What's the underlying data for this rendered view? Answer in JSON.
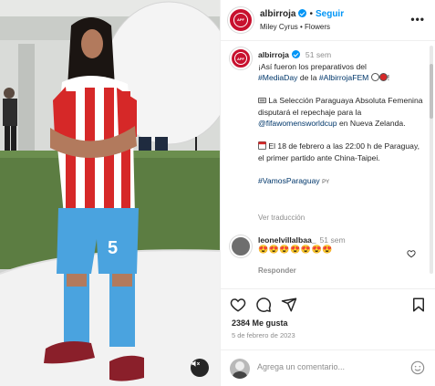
{
  "post": {
    "author": "albirroja",
    "follow_label": "Seguir",
    "audio": "Miley Cyrus • Flowers",
    "more_label": "•••"
  },
  "caption": {
    "username": "albirroja",
    "time": "51 sem",
    "line1_text": "¡Así fueron los preparativos del",
    "line2_tag1": "#MediaDay",
    "line2_mid": " de la ",
    "line2_tag2": "#AlbirrojaFEM",
    "line2_end": "!",
    "p2_start": "La Selección Paraguaya Absoluta Femenina disputará el repechaje para la ",
    "p2_tag": "@fifawomensworldcup",
    "p2_end": " en Nueva Zelanda.",
    "p3_text": "El 18 de febrero a las 22:00 h de Paraguay, el primer partido ante China-Taipei.",
    "p4_tag": "#VamosParaguay",
    "p4_flag": "PY",
    "translate_label": "Ver traducción"
  },
  "comment": {
    "username": "leonelvillalbaa_",
    "time": "51 sem",
    "text": "😍😍😍😍😍😍😍",
    "reply_label": "Responder"
  },
  "stats": {
    "likes": "2384 Me gusta",
    "date": "5 de febrero de 2023"
  },
  "add_comment": {
    "placeholder": "Agrega un comentario..."
  },
  "player": {
    "jersey_number": "5"
  },
  "colors": {
    "accent": "#0095f6",
    "brand_red": "#c8102e",
    "link": "#00376b",
    "muted": "#8e8e8e",
    "shorts_blue": "#4aa3df"
  }
}
